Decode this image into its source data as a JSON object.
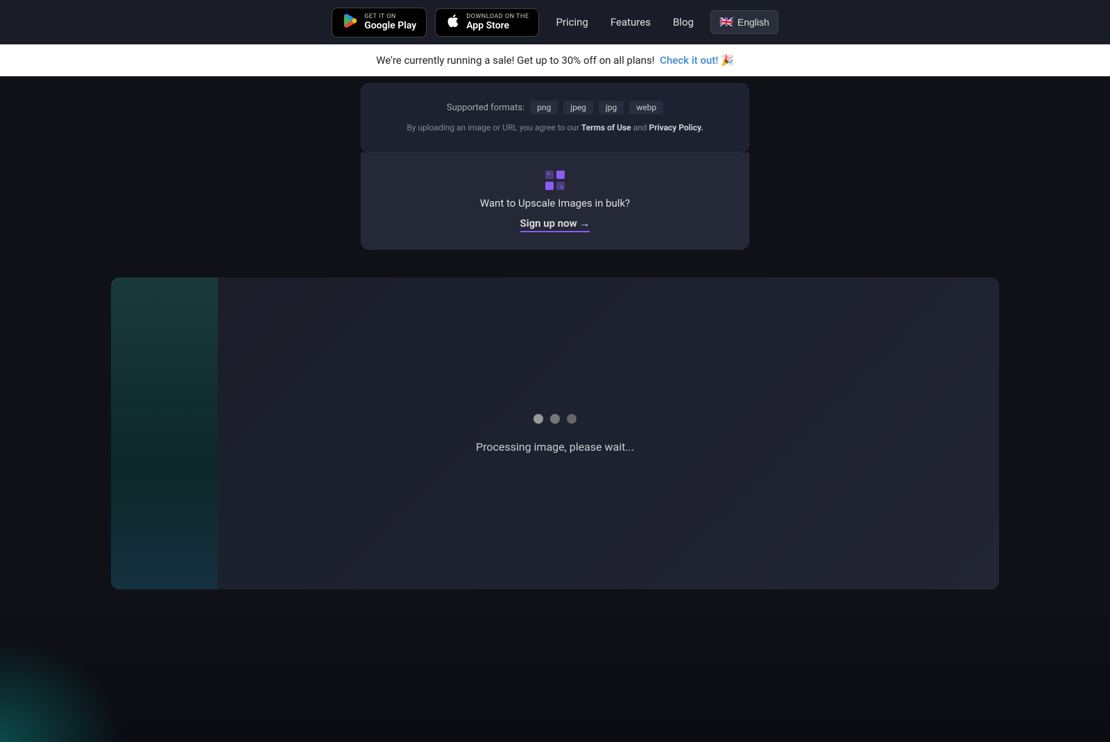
{
  "navbar": {
    "google_play": {
      "line1": "GET IT ON",
      "line2": "Google Play"
    },
    "app_store": {
      "line1": "Download on the",
      "line2": "App Store"
    },
    "links": [
      {
        "label": "Pricing",
        "id": "pricing"
      },
      {
        "label": "Features",
        "id": "features"
      },
      {
        "label": "Blog",
        "id": "blog"
      }
    ],
    "language": {
      "label": "English",
      "flag": "🇬🇧"
    }
  },
  "sale_banner": {
    "text": "We're currently running a sale! Get up to 30% off on all plans!",
    "link_text": "Check it out! 🎉"
  },
  "upload_card": {
    "formats_label": "Supported formats:",
    "formats": [
      "png",
      "jpeg",
      "jpg",
      "webp"
    ],
    "terms_text": "By uploading an image or URL you agree to our",
    "terms_link": "Terms of Use",
    "and_text": "and",
    "privacy_link": "Privacy Policy."
  },
  "bulk_promo": {
    "title": "Want to Upscale Images in bulk?",
    "signup_text": "Sign up now →"
  },
  "processing": {
    "text": "Processing image, please wait..."
  }
}
